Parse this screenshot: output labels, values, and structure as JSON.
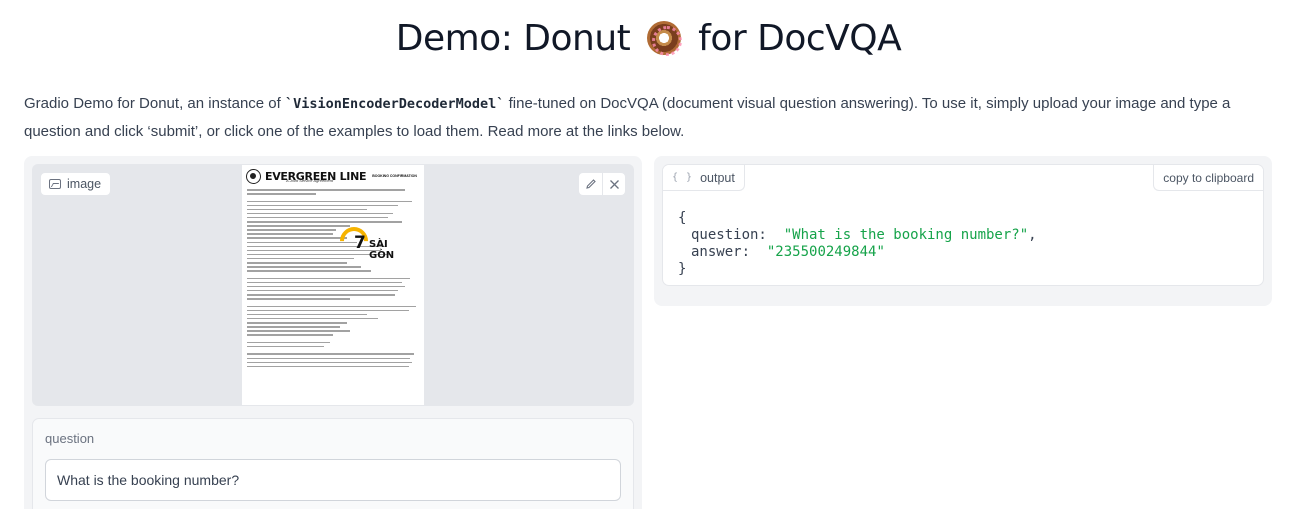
{
  "header": {
    "title_before": "Demo: Donut",
    "emoji_name": "donut-emoji",
    "title_after": "for DocVQA"
  },
  "description": {
    "part1": "Gradio Demo for Donut, an instance of ",
    "code": "`VisionEncoderDecoderModel`",
    "part2": " fine-tuned on DocVQA (document visual question answering). To use it, simply upload your image and type a question and click ‘submit’, or click one of the examples to load them. Read more at the links below."
  },
  "image_component": {
    "label": "image",
    "edit_icon": "pencil-icon",
    "clear_icon": "close-icon",
    "document": {
      "brand": "EVERGREEN LINE",
      "subtitle": "A Joint Service Agreement",
      "booking_label": "BOOKING CONFIRMATION",
      "stamp_number": "7",
      "stamp_text": "SÀI GÒN"
    }
  },
  "question_component": {
    "label": "question",
    "value": "What is the booking number?"
  },
  "output_component": {
    "label": "output",
    "copy_label": "copy to clipboard",
    "open_brace": "{",
    "close_brace": "}",
    "question_key": "question:",
    "question_value": "\"What is the booking number?\"",
    "answer_key": "answer:",
    "answer_value": "\"235500249844\""
  },
  "colors": {
    "panel_bg": "#f3f4f6",
    "json_string": "#16a34a",
    "stamp_accent": "#f6b300"
  }
}
